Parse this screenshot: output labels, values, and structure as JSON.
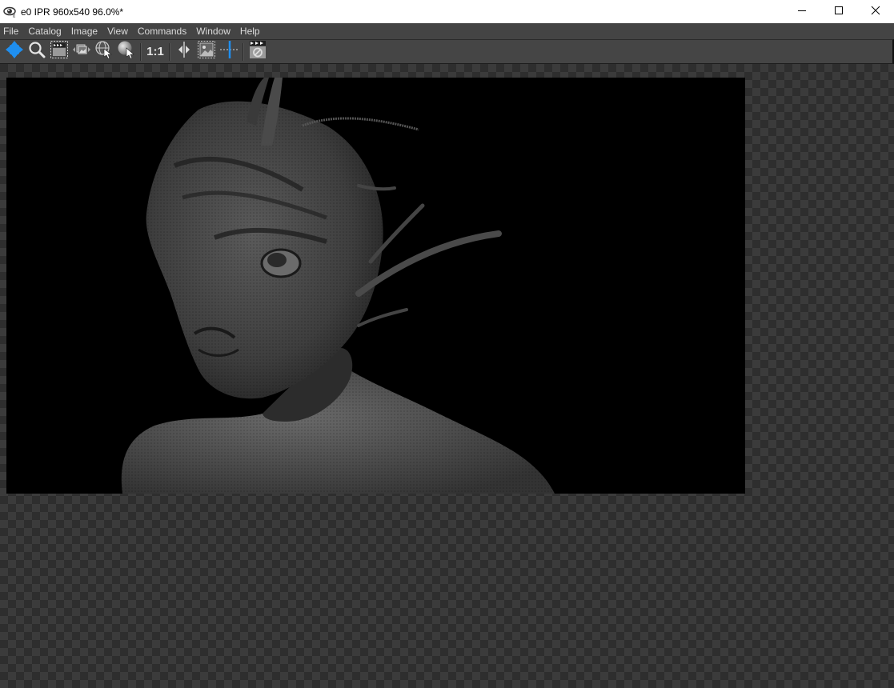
{
  "window": {
    "title": "e0 IPR 960x540 96.0%*",
    "app_icon": "eye-render-icon",
    "controls": {
      "minimize": "minimize-icon",
      "maximize": "maximize-icon",
      "close": "close-icon"
    }
  },
  "menubar": {
    "items": [
      "File",
      "Catalog",
      "Image",
      "View",
      "Commands",
      "Window",
      "Help"
    ]
  },
  "toolbar": {
    "buttons": [
      {
        "icon": "pan-move-icon",
        "tooltip": ""
      },
      {
        "icon": "zoom-magnifier-icon"
      },
      {
        "icon": "render-clapper-region-icon"
      },
      {
        "icon": "render-layers-icon"
      },
      {
        "icon": "globe-pick-icon"
      },
      {
        "icon": "sphere-pick-icon"
      },
      {
        "icon": "actual-size-icon",
        "label": "1:1"
      },
      {
        "icon": "split-compare-icon"
      },
      {
        "icon": "image-region-icon"
      },
      {
        "icon": "crosshair-line-icon"
      },
      {
        "icon": "stop-render-clapper-icon"
      }
    ]
  },
  "viewer": {
    "resolution": "960x540",
    "zoom": "96.0%",
    "content": "3D render of textured alien creature bust on black background",
    "colors": {
      "accent_blue": "#1f8ff0",
      "checker_dark": "#2e2e2e",
      "checker_light": "#3b3b3b"
    }
  }
}
